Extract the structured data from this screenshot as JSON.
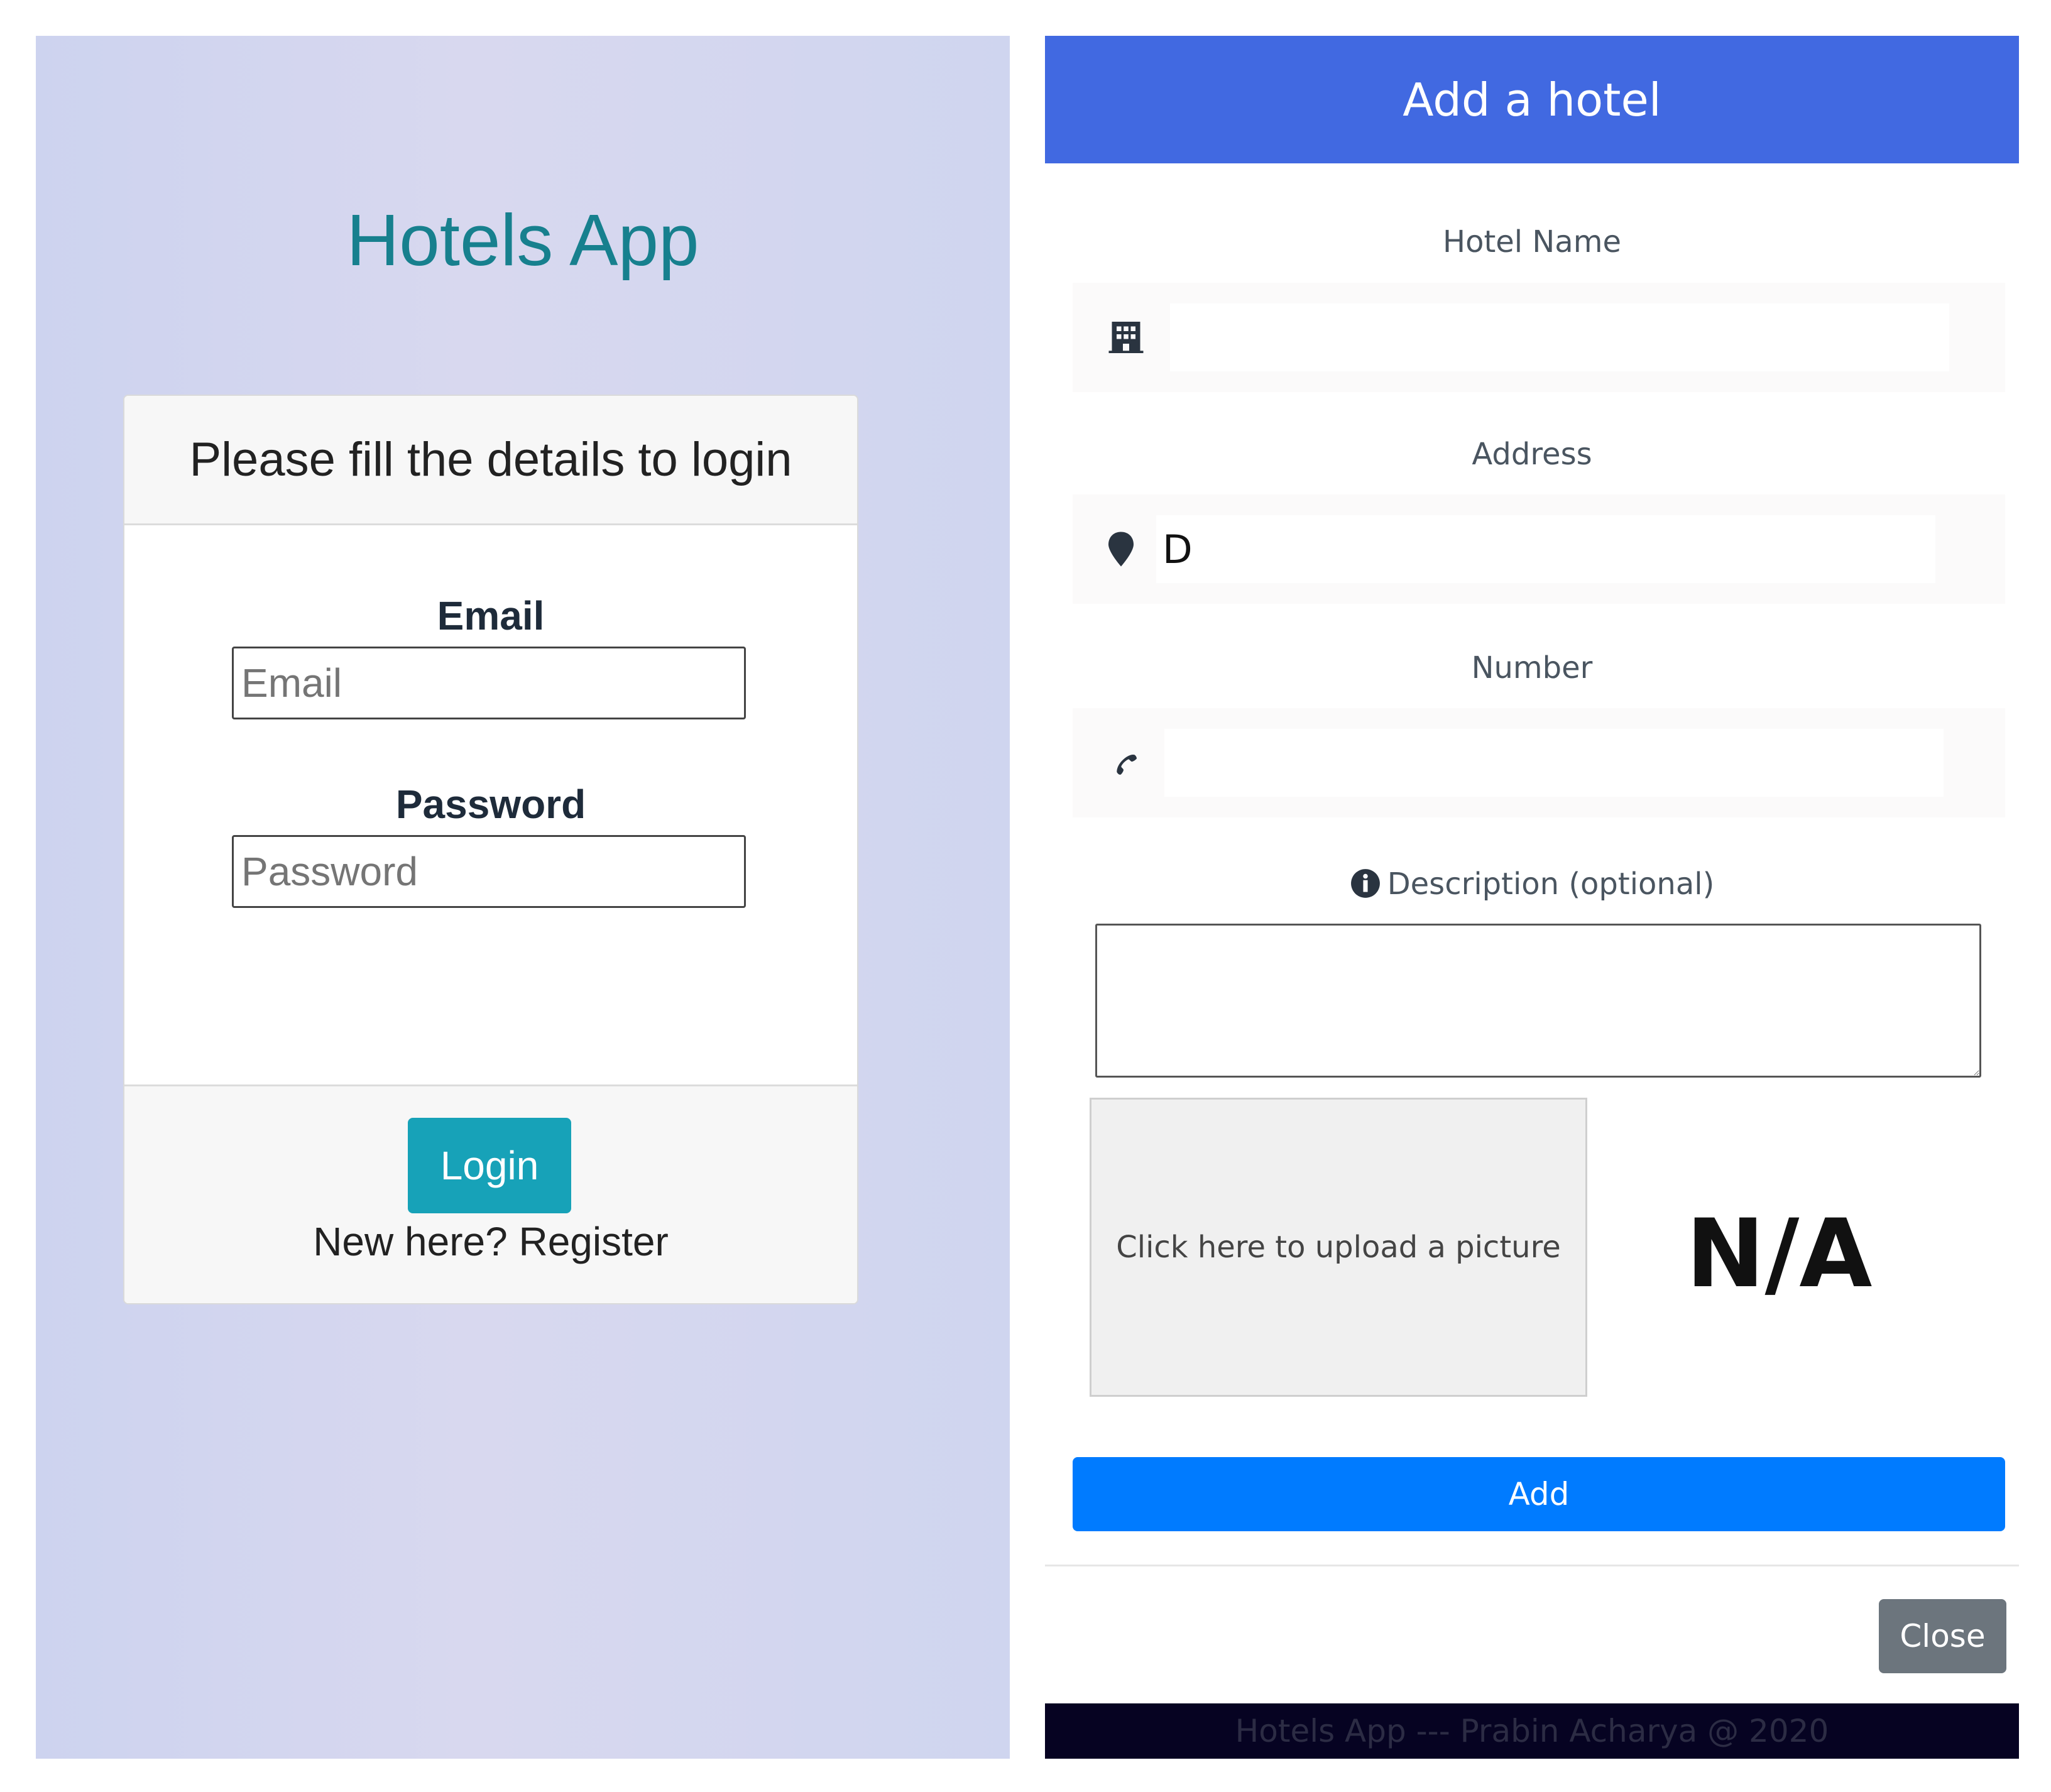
{
  "login": {
    "app_title": "Hotels App",
    "card_header": "Please fill the details to login",
    "email_label": "Email",
    "email_placeholder": "Email",
    "email_value": "",
    "password_label": "Password",
    "password_placeholder": "Password",
    "password_value": "",
    "login_button": "Login",
    "register_text": "New here? Register"
  },
  "add_hotel": {
    "modal_title": "Add a hotel",
    "hotel_name_label": "Hotel Name",
    "hotel_name_value": "",
    "hotel_name_icon": "building-icon",
    "address_label": "Address",
    "address_value": "D",
    "address_icon": "map-marker-icon",
    "number_label": "Number",
    "number_value": "",
    "number_icon": "phone-icon",
    "description_label": "Description (optional)",
    "description_icon": "info-icon",
    "description_value": "",
    "upload_text": "Click here to upload a picture",
    "preview_text": "N/A",
    "add_button": "Add",
    "close_button": "Close",
    "footer_text": "Hotels App --- Prabin Acharya @ 2020"
  },
  "colors": {
    "header_blue": "#4169e1",
    "primary_blue": "#007bff",
    "login_teal": "#17a2b8",
    "close_gray": "#6c757d",
    "footer_dark": "#060322",
    "title_teal": "#17808e"
  }
}
